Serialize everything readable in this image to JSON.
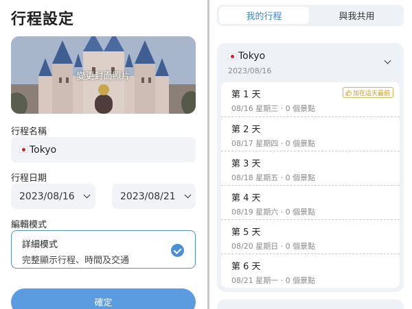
{
  "left": {
    "title": "行程設定",
    "cover": {
      "label": "變更封面照片"
    },
    "name_label": "行程名稱",
    "trip_name": "Tokyo",
    "date_label": "行程日期",
    "start_date": "2023/08/16",
    "end_date": "2023/08/21",
    "mode_label": "編輯模式",
    "mode": {
      "title": "詳細模式",
      "description": "完整顯示行程、時間及交通",
      "selected": true
    },
    "confirm_label": "確定"
  },
  "right": {
    "tabs": [
      {
        "label": "我的行程",
        "active": true
      },
      {
        "label": "與我共用",
        "active": false
      }
    ],
    "trip": {
      "name": "Tokyo",
      "date": "2023/08/16",
      "days": [
        {
          "title": "第 1 天",
          "meta": "08/16 星期三 · 0 個景點",
          "badge": "加在這天最前"
        },
        {
          "title": "第 2 天",
          "meta": "08/17 星期四 · 0 個景點"
        },
        {
          "title": "第 3 天",
          "meta": "08/18 星期五 · 0 個景點"
        },
        {
          "title": "第 4 天",
          "meta": "08/19 星期六 · 0 個景點"
        },
        {
          "title": "第 5 天",
          "meta": "08/20 星期日 · 0 個景點"
        },
        {
          "title": "第 6 天",
          "meta": "08/21 星期一 · 0 個景點"
        }
      ]
    }
  },
  "colors": {
    "accent": "#4a8fd6",
    "button": "#5b9be0",
    "field_bg": "#f1f3f6",
    "badge": "#c89a2e"
  }
}
